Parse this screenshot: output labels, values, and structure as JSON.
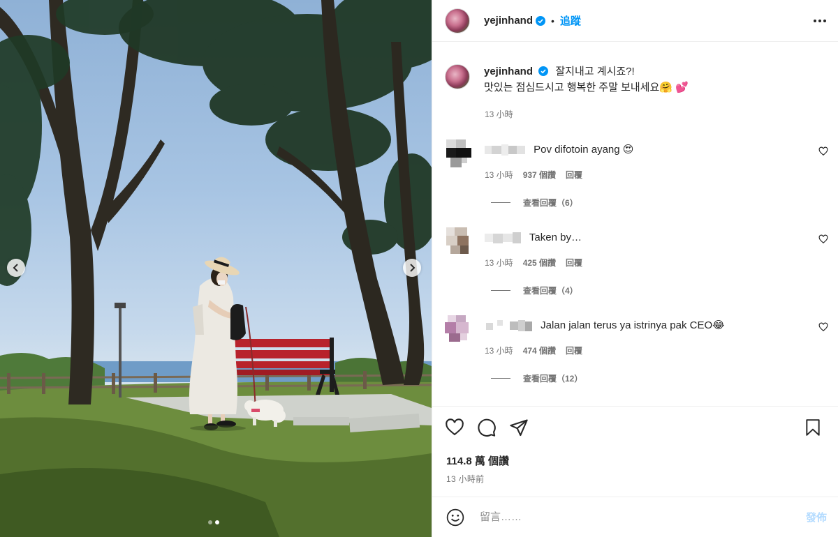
{
  "post": {
    "author": "yejinhand",
    "follow_label": "追蹤",
    "sep": "•",
    "caption_line1": "잘지내고 계시죠?!",
    "caption_line2": "맛있는 점심드시고 행복한 주말 보내세요🤗 💕",
    "caption_time": "13 小時",
    "likes": "114.8 萬 個讚",
    "posted_ago": "13 小時前",
    "carousel": {
      "slides": 2,
      "active": 2
    }
  },
  "comments": [
    {
      "text": "Pov difotoin ayang 😍",
      "time": "13 小時",
      "likes": "937 個讚",
      "reply": "回覆",
      "view_replies": "查看回覆（6）"
    },
    {
      "text": "Taken by…",
      "time": "13 小時",
      "likes": "425 個讚",
      "reply": "回覆",
      "view_replies": "查看回覆（4）"
    },
    {
      "text": "Jalan jalan terus ya istrinya pak CEO😂",
      "time": "13 小時",
      "likes": "474 個讚",
      "reply": "回覆",
      "view_replies": "查看回覆（12）"
    }
  ],
  "composer": {
    "placeholder": "留言……",
    "post_label": "發佈"
  },
  "colors": {
    "accent": "#0095f6",
    "post_disabled": "#b3dbff",
    "muted": "#737373",
    "verified": "#0095f6"
  },
  "icons": [
    "verified-badge-icon",
    "more-options-icon",
    "heart-icon",
    "comment-icon",
    "share-icon",
    "bookmark-icon",
    "emoji-icon",
    "chevron-left-icon",
    "chevron-right-icon"
  ]
}
